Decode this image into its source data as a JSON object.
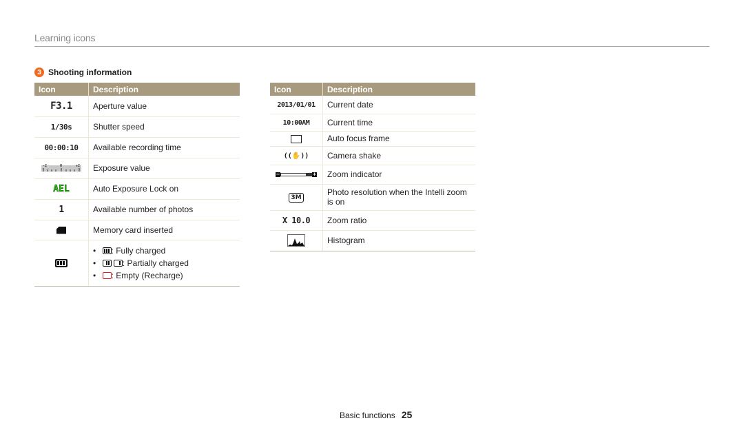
{
  "page": {
    "title": "Learning icons",
    "section_number": "3",
    "section_title": "Shooting information"
  },
  "table_headers": {
    "icon": "Icon",
    "description": "Description"
  },
  "left_table": [
    {
      "icon": "aperture-value-icon",
      "icon_text": "F3.1",
      "description": "Aperture value"
    },
    {
      "icon": "shutter-speed-icon",
      "icon_text": "1/30s",
      "description": "Shutter speed"
    },
    {
      "icon": "recording-time-icon",
      "icon_text": "00:00:10",
      "description": "Available recording time"
    },
    {
      "icon": "exposure-scale-icon",
      "icon_text": "-2 0 +2",
      "description": "Exposure value"
    },
    {
      "icon": "ael-icon",
      "icon_text": "AEL",
      "description": "Auto Exposure Lock on"
    },
    {
      "icon": "photo-count-icon",
      "icon_text": "1",
      "description": "Available number of photos"
    },
    {
      "icon": "memory-card-icon",
      "icon_text": "",
      "description": "Memory card inserted"
    },
    {
      "icon": "battery-icon",
      "icon_text": "",
      "battery_states": [
        {
          "label": ": Fully charged"
        },
        {
          "label": ": Partially charged"
        },
        {
          "label": ": Empty (Recharge)"
        }
      ]
    }
  ],
  "right_table": [
    {
      "icon": "date-icon",
      "icon_text": "2013/01/01",
      "description": "Current date"
    },
    {
      "icon": "time-icon",
      "icon_text": "10:00AM",
      "description": "Current time"
    },
    {
      "icon": "af-frame-icon",
      "icon_text": "",
      "description": "Auto focus frame"
    },
    {
      "icon": "camera-shake-icon",
      "icon_text": "((✋))",
      "description": "Camera shake"
    },
    {
      "icon": "zoom-indicator-icon",
      "icon_text": "",
      "description": "Zoom indicator"
    },
    {
      "icon": "intelli-resolution-icon",
      "icon_text": "3M",
      "description": "Photo resolution when the Intelli zoom is on"
    },
    {
      "icon": "zoom-ratio-icon",
      "icon_text": "X 10.0",
      "description": "Zoom ratio"
    },
    {
      "icon": "histogram-icon",
      "icon_text": "",
      "description": "Histogram"
    }
  ],
  "footer": {
    "section": "Basic functions",
    "page_number": "25"
  },
  "colors": {
    "header_bg": "#a79a7e",
    "badge": "#f06a1f",
    "ael_green": "#36c61c",
    "empty_battery": "#e02020"
  }
}
